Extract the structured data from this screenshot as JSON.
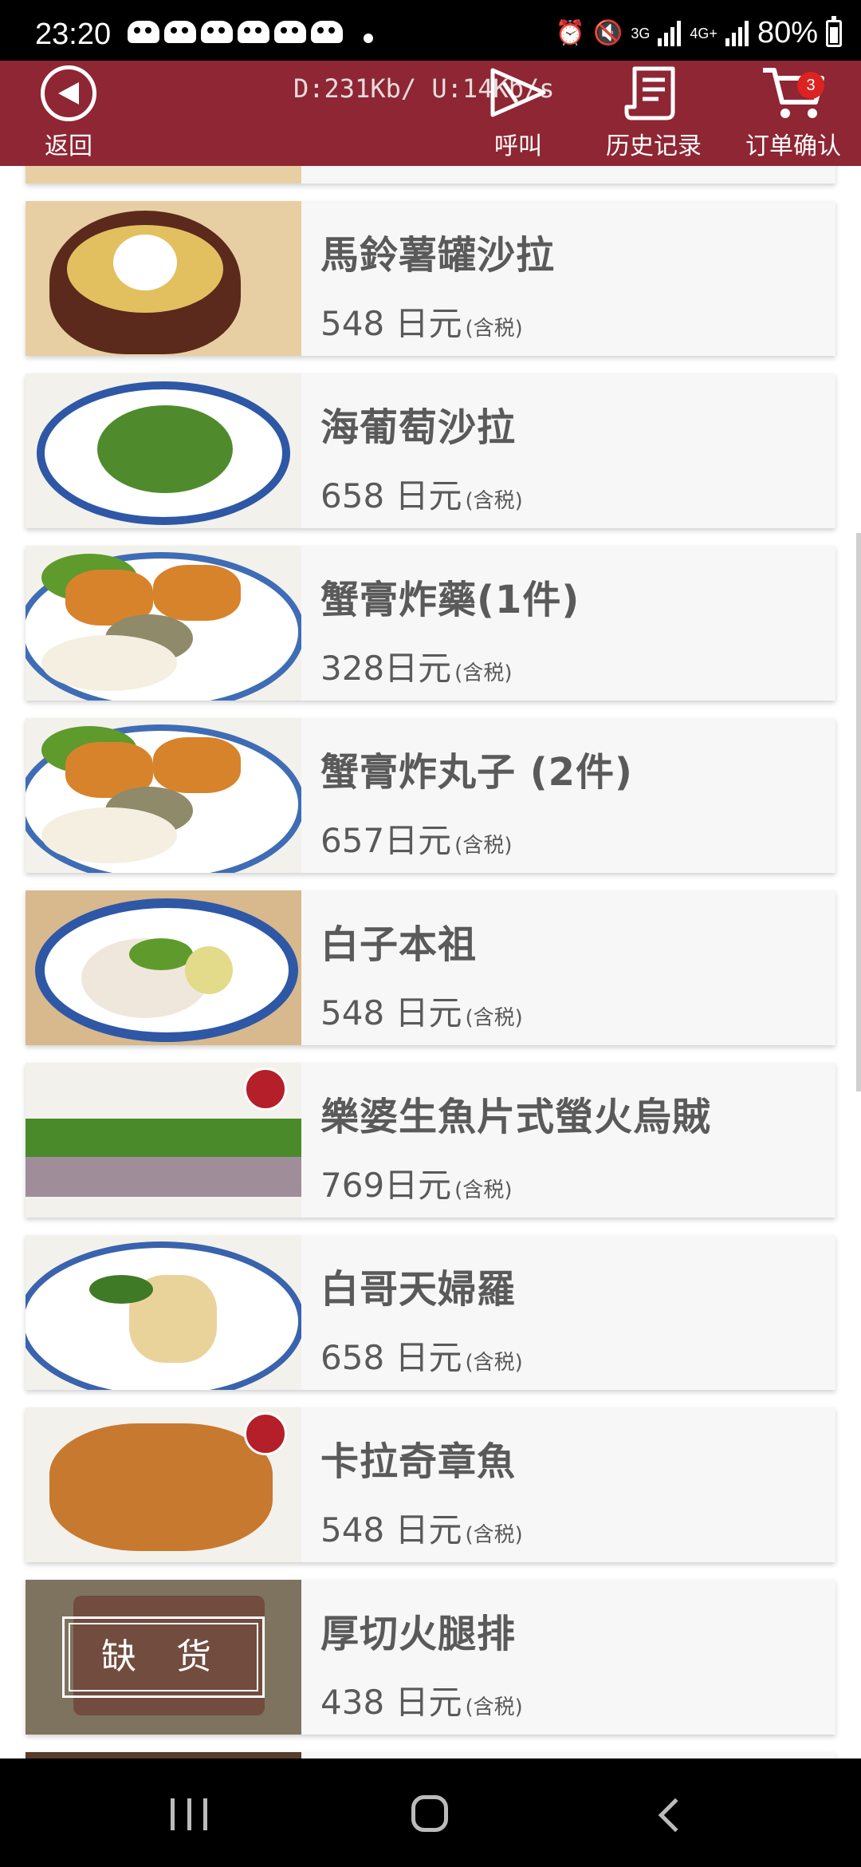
{
  "status_bar": {
    "time": "23:20",
    "network": "3G",
    "network2": "4G+",
    "battery": "80%",
    "icons": [
      "alarm-icon",
      "mute-icon",
      "signal-icon",
      "battery-icon"
    ]
  },
  "header": {
    "back_label": "返回",
    "net_speed": "D:231Kb/  U:14Kb/s",
    "call_label": "呼叫",
    "history_label": "历史记录",
    "cart_label": "订单确认",
    "cart_count": "3",
    "bg_color": "#8e2634"
  },
  "tax_note": "(含税)",
  "soldout_label": "缺 货",
  "menu_items": [
    {
      "name": "馬鈴薯罐沙拉",
      "price": "548 日元"
    },
    {
      "name": "海葡萄沙拉",
      "price": "658 日元"
    },
    {
      "name": "蟹膏炸藥(1件)",
      "price": "328日元"
    },
    {
      "name": "蟹膏炸丸子 (2件)",
      "price": "657日元"
    },
    {
      "name": "白子本祖",
      "price": "548 日元"
    },
    {
      "name": "樂婆生魚片式螢火烏賊",
      "price": "769日元"
    },
    {
      "name": "白哥天婦羅",
      "price": "658 日元"
    },
    {
      "name": "卡拉奇章魚",
      "price": "548 日元"
    },
    {
      "name": "厚切火腿排",
      "price": "438 日元"
    }
  ]
}
